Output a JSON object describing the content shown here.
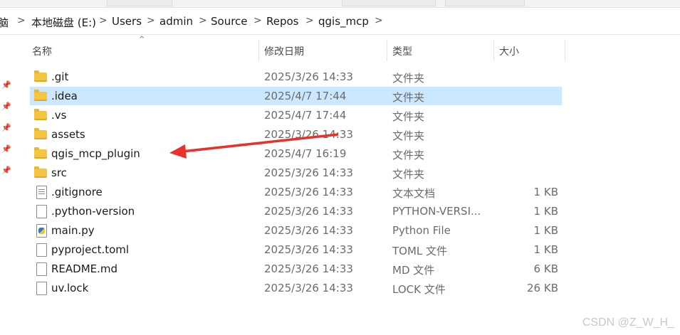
{
  "breadcrumb": {
    "items": [
      "脑",
      "本地磁盘 (E:)",
      "Users",
      "admin",
      "Source",
      "Repos",
      "qgis_mcp"
    ],
    "separator": ">"
  },
  "columns": {
    "name": "名称",
    "date": "修改日期",
    "type": "类型",
    "size": "大小"
  },
  "files": [
    {
      "name": ".git",
      "date": "2025/3/26 14:33",
      "type": "文件夹",
      "size": "",
      "icon": "folder-icon"
    },
    {
      "name": ".idea",
      "date": "2025/4/7 17:44",
      "type": "文件夹",
      "size": "",
      "icon": "folder-icon",
      "selected": true
    },
    {
      "name": ".vs",
      "date": "2025/4/7 17:44",
      "type": "文件夹",
      "size": "",
      "icon": "folder-icon"
    },
    {
      "name": "assets",
      "date": "2025/3/26 14:33",
      "type": "文件夹",
      "size": "",
      "icon": "folder-icon"
    },
    {
      "name": "qgis_mcp_plugin",
      "date": "2025/4/7 16:19",
      "type": "文件夹",
      "size": "",
      "icon": "folder-icon"
    },
    {
      "name": "src",
      "date": "2025/3/26 14:33",
      "type": "文件夹",
      "size": "",
      "icon": "folder-icon"
    },
    {
      "name": ".gitignore",
      "date": "2025/3/26 14:33",
      "type": "文本文档",
      "size": "1 KB",
      "icon": "text-document-icon"
    },
    {
      "name": ".python-version",
      "date": "2025/3/26 14:33",
      "type": "PYTHON-VERSI...",
      "size": "1 KB",
      "icon": "blank-document-icon"
    },
    {
      "name": "main.py",
      "date": "2025/3/26 14:33",
      "type": "Python File",
      "size": "1 KB",
      "icon": "python-file-icon"
    },
    {
      "name": "pyproject.toml",
      "date": "2025/3/26 14:33",
      "type": "TOML 文件",
      "size": "1 KB",
      "icon": "blank-document-icon"
    },
    {
      "name": "README.md",
      "date": "2025/3/26 14:33",
      "type": "MD 文件",
      "size": "6 KB",
      "icon": "blank-document-icon"
    },
    {
      "name": "uv.lock",
      "date": "2025/3/26 14:33",
      "type": "LOCK 文件",
      "size": "26 KB",
      "icon": "blank-document-icon"
    }
  ],
  "annotation": {
    "color": "#e8312a",
    "target": "qgis_mcp_plugin"
  },
  "watermark": "CSDN @Z_W_H_",
  "colors": {
    "selection": "#cce8ff",
    "folder": "#f5c542"
  }
}
